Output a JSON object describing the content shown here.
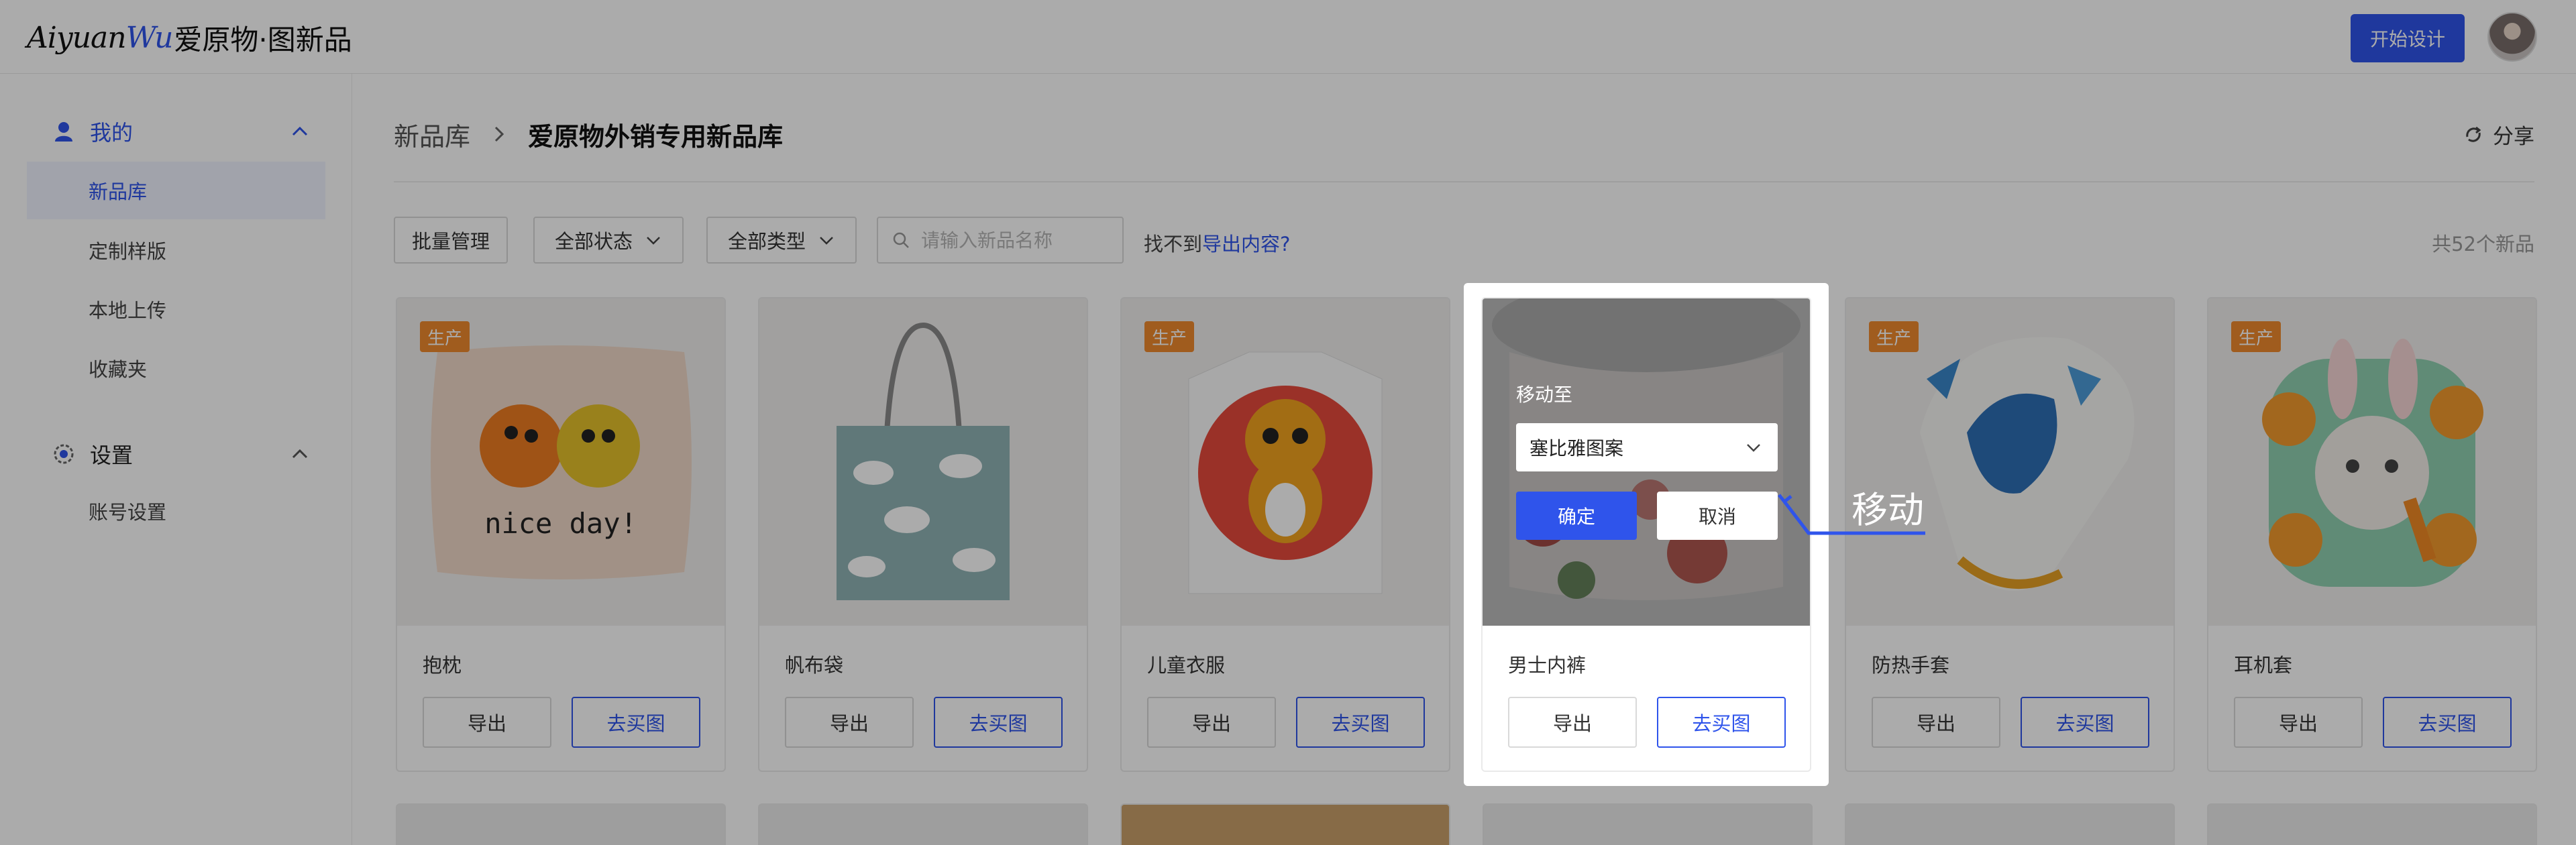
{
  "header": {
    "logo_script_a": "Aiyuan",
    "logo_script_b": "Wu",
    "logo_cn": "爱原物·图新品",
    "start_button": "开始设计"
  },
  "sidebar": {
    "group_mine": "我的",
    "items": [
      "新品库",
      "定制样版",
      "本地上传",
      "收藏夹"
    ],
    "group_settings": "设置",
    "settings_items": [
      "账号设置"
    ]
  },
  "breadcrumb": {
    "root": "新品库",
    "current": "爱原物外销专用新品库"
  },
  "share_label": "分享",
  "toolbar": {
    "batch": "批量管理",
    "status": "全部状态",
    "type": "全部类型",
    "search_placeholder": "请输入新品名称",
    "notfound_prefix": "找不到",
    "notfound_link": "导出内容?",
    "count": "共52个新品"
  },
  "cards": [
    {
      "name": "抱枕",
      "badge": "生产",
      "export": "导出",
      "buy": "去买图"
    },
    {
      "name": "帆布袋",
      "badge": "",
      "export": "导出",
      "buy": "去买图"
    },
    {
      "name": "儿童衣服",
      "badge": "生产",
      "export": "导出",
      "buy": "去买图"
    },
    {
      "name": "男士内裤",
      "badge": "",
      "export": "导出",
      "buy": "去买图"
    },
    {
      "name": "防热手套",
      "badge": "生产",
      "export": "导出",
      "buy": "去买图"
    },
    {
      "name": "耳机套",
      "badge": "生产",
      "export": "导出",
      "buy": "去买图"
    }
  ],
  "move_dialog": {
    "label": "移动至",
    "selected": "塞比雅图案",
    "confirm": "确定",
    "cancel": "取消"
  },
  "annotation": "移动",
  "colors": {
    "accent": "#2f54eb",
    "badge": "#ef8a2e"
  }
}
